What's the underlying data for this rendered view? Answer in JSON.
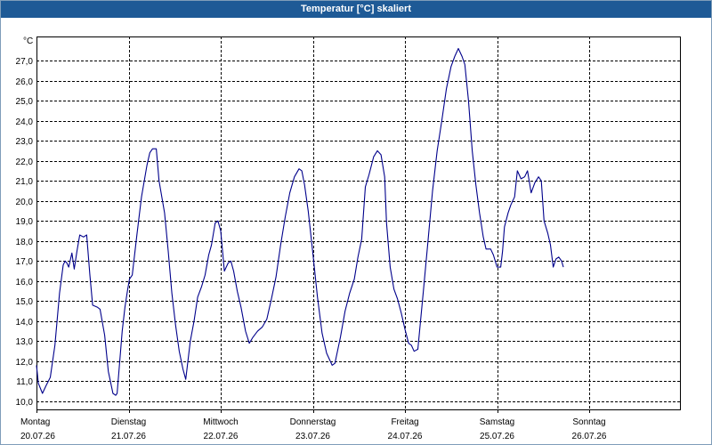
{
  "window": {
    "title": "Temperatur [°C] skaliert"
  },
  "chart_data": {
    "type": "line",
    "title": "Temperatur [°C] skaliert",
    "unit": "°C",
    "ylim": [
      9.6,
      28.2
    ],
    "xlim": [
      0,
      7
    ],
    "grid": true,
    "y_ticks": [
      10.0,
      11.0,
      12.0,
      13.0,
      14.0,
      15.0,
      16.0,
      17.0,
      18.0,
      19.0,
      20.0,
      21.0,
      22.0,
      23.0,
      24.0,
      25.0,
      26.0,
      27.0
    ],
    "y_tick_labels": [
      "10,0",
      "11,0",
      "12,0",
      "13,0",
      "14,0",
      "15,0",
      "16,0",
      "17,0",
      "18,0",
      "19,0",
      "20,0",
      "21,0",
      "22,0",
      "23,0",
      "24,0",
      "25,0",
      "26,0",
      "27,0"
    ],
    "days": [
      {
        "x": 0,
        "name": "Montag",
        "date": "20.07.26"
      },
      {
        "x": 1,
        "name": "Dienstag",
        "date": "21.07.26"
      },
      {
        "x": 2,
        "name": "Mittwoch",
        "date": "22.07.26"
      },
      {
        "x": 3,
        "name": "Donnerstag",
        "date": "23.07.26"
      },
      {
        "x": 4,
        "name": "Freitag",
        "date": "24.07.26"
      },
      {
        "x": 5,
        "name": "Samstag",
        "date": "25.07.26"
      },
      {
        "x": 6,
        "name": "Sonntag",
        "date": "26.07.26"
      }
    ],
    "series": [
      {
        "color": "#00008b",
        "points": [
          [
            0.0,
            11.8
          ],
          [
            0.02,
            10.9
          ],
          [
            0.065,
            10.4
          ],
          [
            0.105,
            10.8
          ],
          [
            0.15,
            11.2
          ],
          [
            0.2,
            12.8
          ],
          [
            0.25,
            15.4
          ],
          [
            0.29,
            16.8
          ],
          [
            0.31,
            17.0
          ],
          [
            0.33,
            16.9
          ],
          [
            0.35,
            16.7
          ],
          [
            0.385,
            17.4
          ],
          [
            0.41,
            16.6
          ],
          [
            0.44,
            17.5
          ],
          [
            0.47,
            18.3
          ],
          [
            0.51,
            18.2
          ],
          [
            0.545,
            18.3
          ],
          [
            0.58,
            16.3
          ],
          [
            0.61,
            14.8
          ],
          [
            0.66,
            14.7
          ],
          [
            0.69,
            14.6
          ],
          [
            0.74,
            13.3
          ],
          [
            0.78,
            11.5
          ],
          [
            0.83,
            10.4
          ],
          [
            0.86,
            10.3
          ],
          [
            0.875,
            10.4
          ],
          [
            0.93,
            13.5
          ],
          [
            0.96,
            14.7
          ],
          [
            0.99,
            15.6
          ],
          [
            1.01,
            16.1
          ],
          [
            1.04,
            16.3
          ],
          [
            1.09,
            18.3
          ],
          [
            1.14,
            20.2
          ],
          [
            1.2,
            21.8
          ],
          [
            1.23,
            22.4
          ],
          [
            1.26,
            22.6
          ],
          [
            1.3,
            22.6
          ],
          [
            1.33,
            21.0
          ],
          [
            1.36,
            20.2
          ],
          [
            1.39,
            19.4
          ],
          [
            1.43,
            17.5
          ],
          [
            1.47,
            15.4
          ],
          [
            1.51,
            13.8
          ],
          [
            1.55,
            12.5
          ],
          [
            1.59,
            11.6
          ],
          [
            1.62,
            11.1
          ],
          [
            1.67,
            13.0
          ],
          [
            1.71,
            14.0
          ],
          [
            1.75,
            15.2
          ],
          [
            1.79,
            15.7
          ],
          [
            1.83,
            16.3
          ],
          [
            1.87,
            17.3
          ],
          [
            1.9,
            17.8
          ],
          [
            1.94,
            18.9
          ],
          [
            1.97,
            19.0
          ],
          [
            2.0,
            18.5
          ],
          [
            2.04,
            16.5
          ],
          [
            2.08,
            16.9
          ],
          [
            2.11,
            17.0
          ],
          [
            2.14,
            16.5
          ],
          [
            2.18,
            15.5
          ],
          [
            2.22,
            14.7
          ],
          [
            2.27,
            13.5
          ],
          [
            2.31,
            12.9
          ],
          [
            2.35,
            13.2
          ],
          [
            2.4,
            13.5
          ],
          [
            2.45,
            13.7
          ],
          [
            2.5,
            14.1
          ],
          [
            2.55,
            15.1
          ],
          [
            2.6,
            16.2
          ],
          [
            2.65,
            17.8
          ],
          [
            2.7,
            19.2
          ],
          [
            2.75,
            20.4
          ],
          [
            2.8,
            21.2
          ],
          [
            2.85,
            21.6
          ],
          [
            2.88,
            21.5
          ],
          [
            2.91,
            20.8
          ],
          [
            2.95,
            19.5
          ],
          [
            3.0,
            17.4
          ],
          [
            3.05,
            15.2
          ],
          [
            3.1,
            13.4
          ],
          [
            3.15,
            12.4
          ],
          [
            3.21,
            11.8
          ],
          [
            3.24,
            11.9
          ],
          [
            3.3,
            13.2
          ],
          [
            3.35,
            14.5
          ],
          [
            3.4,
            15.4
          ],
          [
            3.45,
            16.1
          ],
          [
            3.49,
            17.2
          ],
          [
            3.53,
            18.1
          ],
          [
            3.57,
            20.7
          ],
          [
            3.61,
            21.3
          ],
          [
            3.66,
            22.2
          ],
          [
            3.7,
            22.5
          ],
          [
            3.74,
            22.3
          ],
          [
            3.78,
            21.2
          ],
          [
            3.8,
            18.9
          ],
          [
            3.84,
            16.7
          ],
          [
            3.88,
            15.6
          ],
          [
            3.92,
            15.1
          ],
          [
            3.96,
            14.4
          ],
          [
            4.0,
            13.6
          ],
          [
            4.04,
            12.9
          ],
          [
            4.07,
            12.8
          ],
          [
            4.1,
            12.5
          ],
          [
            4.14,
            12.6
          ],
          [
            4.2,
            15.5
          ],
          [
            4.25,
            18.0
          ],
          [
            4.3,
            20.5
          ],
          [
            4.35,
            22.5
          ],
          [
            4.4,
            24.0
          ],
          [
            4.45,
            25.6
          ],
          [
            4.5,
            26.7
          ],
          [
            4.54,
            27.2
          ],
          [
            4.58,
            27.6
          ],
          [
            4.62,
            27.2
          ],
          [
            4.65,
            26.8
          ],
          [
            4.69,
            25.0
          ],
          [
            4.73,
            22.5
          ],
          [
            4.77,
            20.8
          ],
          [
            4.81,
            19.4
          ],
          [
            4.85,
            18.2
          ],
          [
            4.88,
            17.6
          ],
          [
            4.93,
            17.6
          ],
          [
            4.96,
            17.3
          ],
          [
            5.0,
            16.7
          ],
          [
            5.04,
            16.7
          ],
          [
            5.06,
            17.5
          ],
          [
            5.08,
            18.7
          ],
          [
            5.12,
            19.4
          ],
          [
            5.15,
            19.8
          ],
          [
            5.19,
            20.2
          ],
          [
            5.22,
            21.5
          ],
          [
            5.26,
            21.1
          ],
          [
            5.3,
            21.2
          ],
          [
            5.33,
            21.5
          ],
          [
            5.37,
            20.4
          ],
          [
            5.41,
            20.9
          ],
          [
            5.45,
            21.2
          ],
          [
            5.48,
            21.0
          ],
          [
            5.51,
            19.0
          ],
          [
            5.55,
            18.4
          ],
          [
            5.58,
            17.8
          ],
          [
            5.61,
            16.7
          ],
          [
            5.64,
            17.1
          ],
          [
            5.67,
            17.2
          ],
          [
            5.7,
            17.0
          ],
          [
            5.72,
            16.7
          ]
        ]
      }
    ]
  }
}
